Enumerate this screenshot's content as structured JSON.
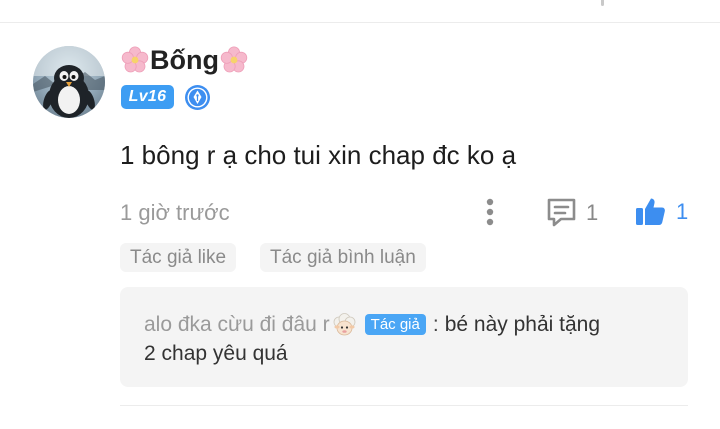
{
  "comment": {
    "username": "Bống",
    "level": "Lv16",
    "text": "1 bông r ạ cho tui xin chap đc ko ạ",
    "timestamp": "1 giờ trước",
    "reply_count": "1",
    "like_count": "1",
    "tags": [
      "Tác giả like",
      "Tác giả bình luận"
    ]
  },
  "reply": {
    "username": "alo đka cừu đi đâu r",
    "author_badge": "Tác giả",
    "colon": ":",
    "text_line1": "bé này phải tặng",
    "text_line2": "2 chap yêu quá"
  },
  "icons": {
    "avatar": "penguin-avatar",
    "name_decoration": "cherry-blossom-icon",
    "writer_badge": "pen-nib-icon",
    "more": "vertical-dots-icon",
    "reply": "comment-bubble-icon",
    "like": "thumbs-up-icon",
    "reply_user_decoration": "sheep-emoji"
  },
  "colors": {
    "accent": "#3d8ef0",
    "level_badge": "#3d9df3",
    "author_badge": "#4aa6f5",
    "blossom": "#f6b9cc",
    "muted_text": "#9a9a9a",
    "chip_bg": "#f4f4f4"
  }
}
